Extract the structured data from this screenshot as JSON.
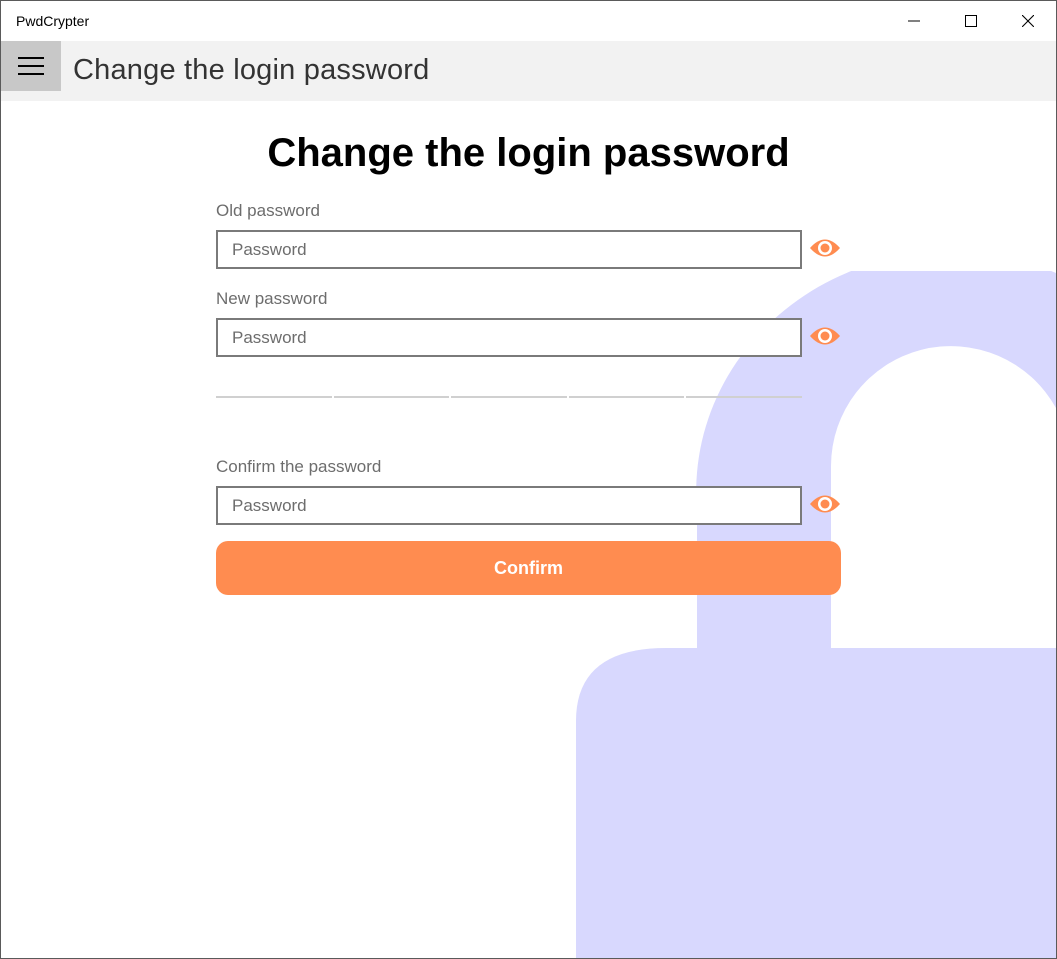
{
  "window": {
    "title": "PwdCrypter",
    "controls": [
      "minimize-icon",
      "maximize-icon",
      "close-icon"
    ]
  },
  "header": {
    "menu_icon": "hamburger-icon",
    "title": "Change the login password"
  },
  "main": {
    "heading": "Change the login password",
    "old_password": {
      "label": "Old password",
      "placeholder": "Password",
      "value": "",
      "toggle_icon": "eye-icon"
    },
    "new_password": {
      "label": "New password",
      "placeholder": "Password",
      "value": "",
      "toggle_icon": "eye-icon"
    },
    "strength_meter": {
      "segments": 5,
      "filled": 0
    },
    "confirm_password": {
      "label": "Confirm the password",
      "placeholder": "Password",
      "value": "",
      "toggle_icon": "eye-icon"
    },
    "confirm_button": "Confirm",
    "background_icon": "lock-icon"
  },
  "colors": {
    "accent": "#ff8c50",
    "lock_background": "#d8d8fe",
    "header_background": "#f2f2f2"
  }
}
